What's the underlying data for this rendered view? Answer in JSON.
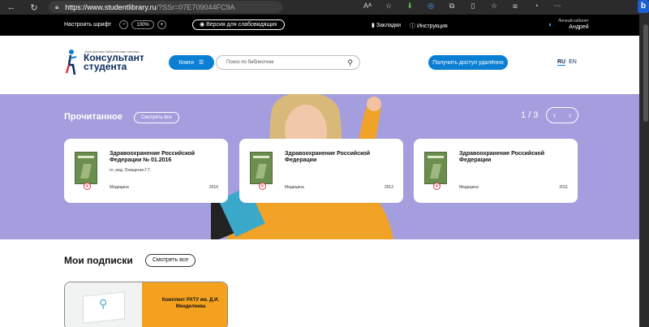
{
  "browser": {
    "url_host": "https://www.studentlibrary.ru",
    "url_path": "/?SSr=07E709044FC9A"
  },
  "topbar": {
    "font_label": "Настроить шрифт",
    "font_minus": "−",
    "font_zoom": "100%",
    "font_plus": "+",
    "version_label": "Версия для слабовидящих",
    "bookmarks_label": "Закладки",
    "help_label": "Инструкция",
    "cabinet_label": "Личный кабинет",
    "user_name": "Андрей"
  },
  "header": {
    "logo_small": "Электронная библиотечная система",
    "logo_line1": "Консультант",
    "logo_line2": "студента",
    "books_label": "Книги",
    "search_placeholder": "Поиск по библиотеке",
    "remote_label": "Получить доступ удалённо",
    "lang_ru": "RU",
    "lang_en": "EN"
  },
  "hero": {
    "title": "Прочитанное",
    "see_all": "Смотреть все",
    "pager": "1 / 3",
    "prev": "‹",
    "next": "›",
    "cards": [
      {
        "title": "Здравоохранение Российской Федерации № 01.2016",
        "author": "гл. ред. Онищенко Г.Г.",
        "subject": "Медицина",
        "year": "2016"
      },
      {
        "title": "Здравоохранение Российской Федерации",
        "author": "",
        "subject": "Медицина",
        "year": "2012"
      },
      {
        "title": "Здравоохранение Российской Федерации",
        "author": "",
        "subject": "Медицина",
        "year": "2011"
      }
    ]
  },
  "subscriptions": {
    "title": "Мои подписки",
    "see_all": "Смотреть все",
    "items": [
      {
        "name": "Комплект РХТУ им. Д.И. Менделеева"
      }
    ]
  },
  "colors": {
    "accent": "#0b7fd4",
    "hero_bg": "#a59ede",
    "subscription": "#f4a21e"
  }
}
